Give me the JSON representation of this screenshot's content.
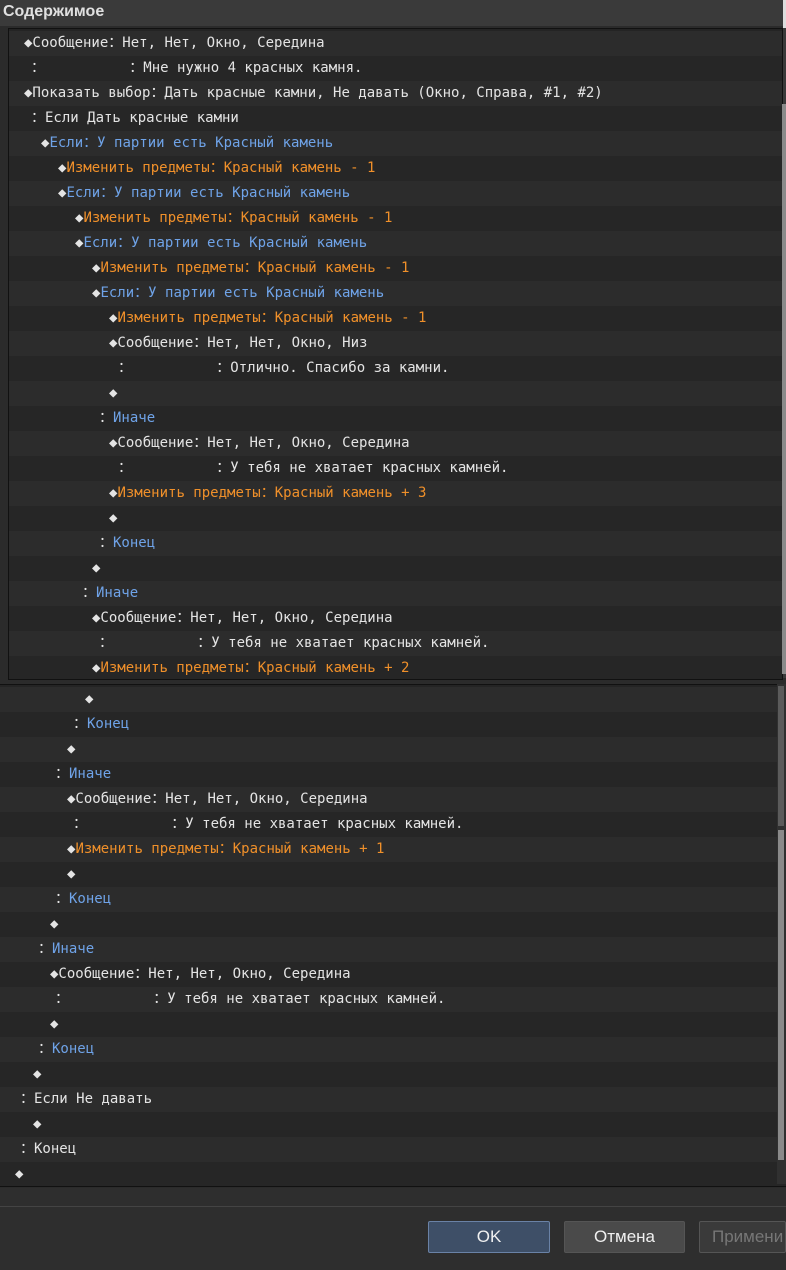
{
  "window": {
    "title": "Содержимое"
  },
  "list_top": {
    "rows": [
      [
        {
          "t": "◆Сообщение",
          "c": "white"
        },
        {
          "t": "：Нет, Нет, Окно, Середина",
          "c": "white"
        }
      ],
      [
        {
          "t": "：",
          "c": "white"
        },
        {
          "t": "          ：Мне нужно 4 красных камня.",
          "c": "white"
        }
      ],
      [
        {
          "t": "◆Показать выбор",
          "c": "white"
        },
        {
          "t": "：Дать красные камни, Не давать (Окно, Справа, #1, #2)",
          "c": "white"
        }
      ],
      [
        {
          "t": "：Если Дать красные камни",
          "c": "white"
        }
      ],
      [
        {
          "t": "◆",
          "c": "white"
        },
        {
          "t": "Если：У партии есть Красный камень",
          "c": "blue"
        }
      ],
      [
        {
          "t": "◆",
          "c": "white"
        },
        {
          "t": "Изменить предметы：Красный камень - 1",
          "c": "orange"
        }
      ],
      [
        {
          "t": "◆",
          "c": "white"
        },
        {
          "t": "Если：У партии есть Красный камень",
          "c": "blue"
        }
      ],
      [
        {
          "t": "◆",
          "c": "white"
        },
        {
          "t": "Изменить предметы：Красный камень - 1",
          "c": "orange"
        }
      ],
      [
        {
          "t": "◆",
          "c": "white"
        },
        {
          "t": "Если：У партии есть Красный камень",
          "c": "blue"
        }
      ],
      [
        {
          "t": "◆",
          "c": "white"
        },
        {
          "t": "Изменить предметы：Красный камень - 1",
          "c": "orange"
        }
      ],
      [
        {
          "t": "◆",
          "c": "white"
        },
        {
          "t": "Если：У партии есть Красный камень",
          "c": "blue"
        }
      ],
      [
        {
          "t": "◆",
          "c": "white"
        },
        {
          "t": "Изменить предметы：Красный камень - 1",
          "c": "orange"
        }
      ],
      [
        {
          "t": "◆Сообщение",
          "c": "white"
        },
        {
          "t": "：Нет, Нет, Окно, Низ",
          "c": "white"
        }
      ],
      [
        {
          "t": "：",
          "c": "white"
        },
        {
          "t": "          ：Отлично. Спасибо за камни.",
          "c": "white"
        }
      ],
      [
        {
          "t": "◆",
          "c": "white"
        }
      ],
      [
        {
          "t": "：",
          "c": "white"
        },
        {
          "t": "Иначе",
          "c": "blue"
        }
      ],
      [
        {
          "t": "◆Сообщение",
          "c": "white"
        },
        {
          "t": "：Нет, Нет, Окно, Середина",
          "c": "white"
        }
      ],
      [
        {
          "t": "：",
          "c": "white"
        },
        {
          "t": "          ：У тебя не хватает красных камней.",
          "c": "white"
        }
      ],
      [
        {
          "t": "◆",
          "c": "white"
        },
        {
          "t": "Изменить предметы：Красный камень + 3",
          "c": "orange"
        }
      ],
      [
        {
          "t": "◆",
          "c": "white"
        }
      ],
      [
        {
          "t": "：",
          "c": "white"
        },
        {
          "t": "Конец",
          "c": "blue"
        }
      ],
      [
        {
          "t": "◆",
          "c": "white"
        }
      ],
      [
        {
          "t": "：",
          "c": "white"
        },
        {
          "t": "Иначе",
          "c": "blue"
        }
      ],
      [
        {
          "t": "◆Сообщение",
          "c": "white"
        },
        {
          "t": "：Нет, Нет, Окно, Середина",
          "c": "white"
        }
      ],
      [
        {
          "t": "：",
          "c": "white"
        },
        {
          "t": "          ：У тебя не хватает красных камней.",
          "c": "white"
        }
      ],
      [
        {
          "t": "◆",
          "c": "white"
        },
        {
          "t": "Изменить предметы：Красный камень + 2",
          "c": "orange"
        }
      ]
    ]
  },
  "list_bottom": {
    "rows": [
      [
        {
          "t": "◆",
          "c": "white"
        }
      ],
      [
        {
          "t": "：",
          "c": "white"
        },
        {
          "t": "Конец",
          "c": "blue"
        }
      ],
      [
        {
          "t": "◆",
          "c": "white"
        }
      ],
      [
        {
          "t": "：",
          "c": "white"
        },
        {
          "t": "Иначе",
          "c": "blue"
        }
      ],
      [
        {
          "t": "◆Сообщение",
          "c": "white"
        },
        {
          "t": "：Нет, Нет, Окно, Середина",
          "c": "white"
        }
      ],
      [
        {
          "t": "：",
          "c": "white"
        },
        {
          "t": "          ：У тебя не хватает красных камней.",
          "c": "white"
        }
      ],
      [
        {
          "t": "◆",
          "c": "white"
        },
        {
          "t": "Изменить предметы：Красный камень + 1",
          "c": "orange"
        }
      ],
      [
        {
          "t": "◆",
          "c": "white"
        }
      ],
      [
        {
          "t": "：",
          "c": "white"
        },
        {
          "t": "Конец",
          "c": "blue"
        }
      ],
      [
        {
          "t": "◆",
          "c": "white"
        }
      ],
      [
        {
          "t": "：",
          "c": "white"
        },
        {
          "t": "Иначе",
          "c": "blue"
        }
      ],
      [
        {
          "t": "◆Сообщение",
          "c": "white"
        },
        {
          "t": "：Нет, Нет, Окно, Середина",
          "c": "white"
        }
      ],
      [
        {
          "t": "：",
          "c": "white"
        },
        {
          "t": "          ：У тебя не хватает красных камней.",
          "c": "white"
        }
      ],
      [
        {
          "t": "◆",
          "c": "white"
        }
      ],
      [
        {
          "t": "：",
          "c": "white"
        },
        {
          "t": "Конец",
          "c": "blue"
        }
      ],
      [
        {
          "t": "◆",
          "c": "white"
        }
      ],
      [
        {
          "t": "：Если Не давать",
          "c": "white"
        }
      ],
      [
        {
          "t": "◆",
          "c": "white"
        }
      ],
      [
        {
          "t": "：Конец",
          "c": "white"
        }
      ],
      [
        {
          "t": "◆",
          "c": "white"
        }
      ]
    ]
  },
  "buttons": {
    "ok": "OK",
    "cancel": "Отмена",
    "apply": "Примени"
  },
  "colors": {
    "condition": "#6fa3e8",
    "item_change": "#f0902a",
    "text": "#e4e4e4",
    "ok_button": "#3e4f67"
  }
}
